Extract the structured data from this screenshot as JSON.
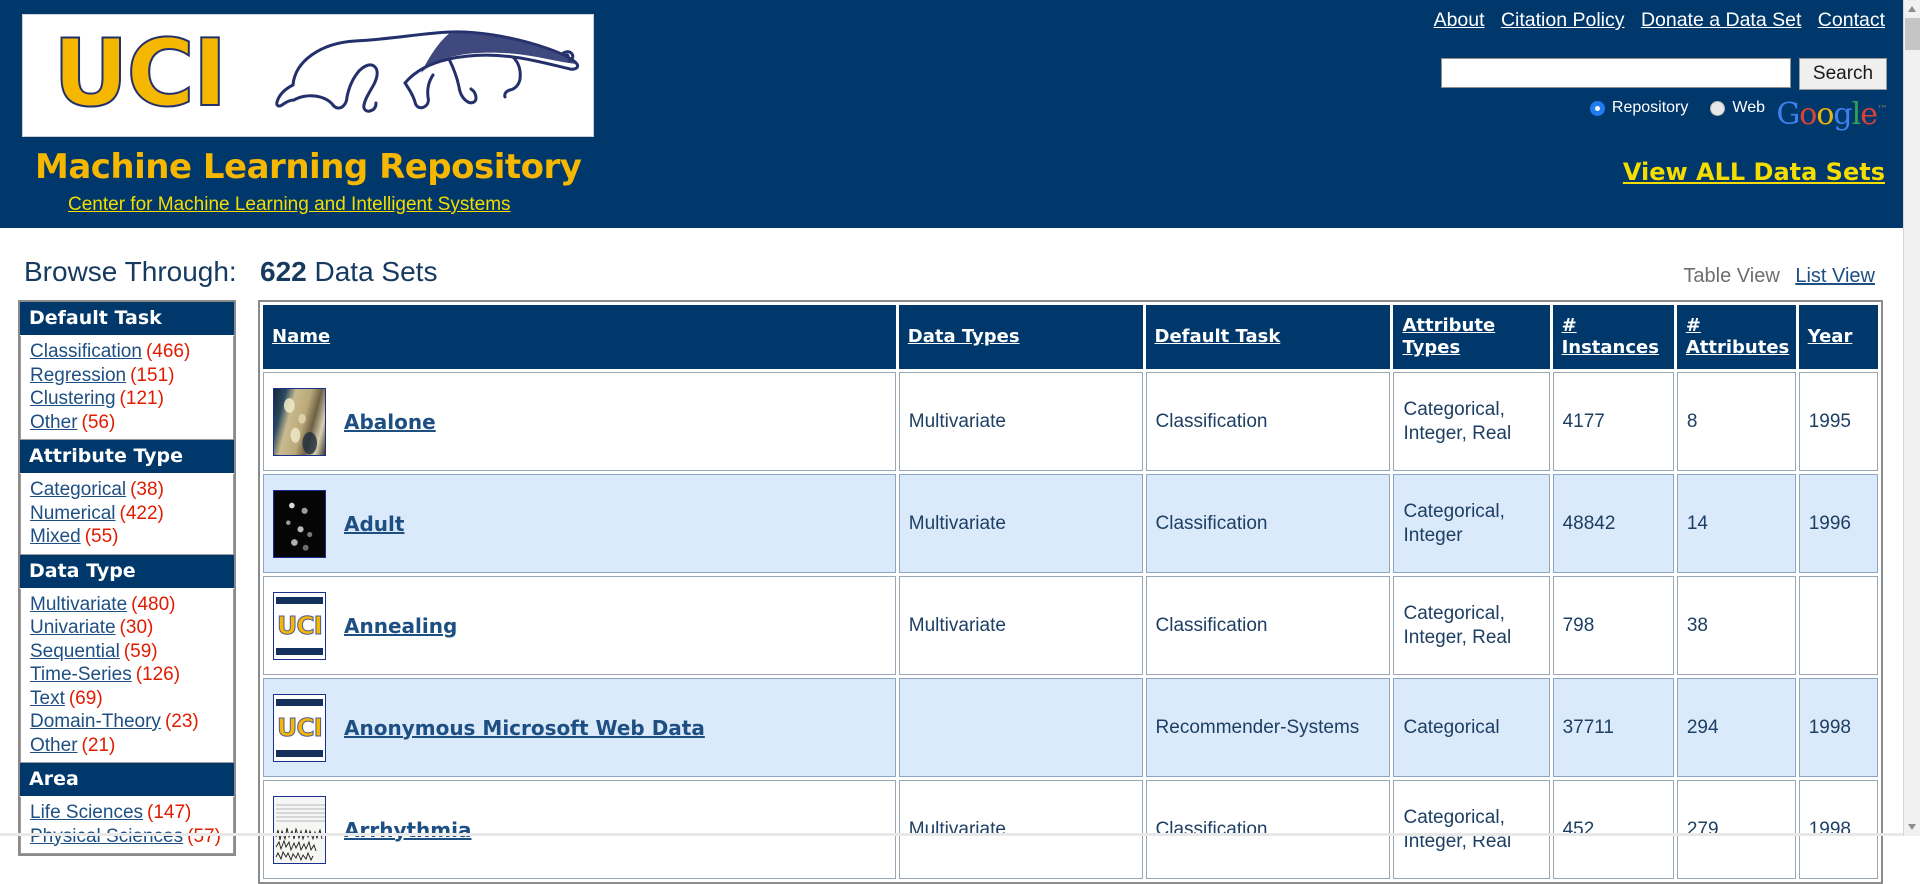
{
  "header": {
    "logo_text": "UCI",
    "logo_anteater_alt": "anteater-logo",
    "title": "Machine Learning Repository",
    "subtitle": "Center for Machine Learning and Intelligent Systems",
    "nav": [
      {
        "label": "About"
      },
      {
        "label": "Citation Policy"
      },
      {
        "label": "Donate a Data Set"
      },
      {
        "label": "Contact"
      }
    ],
    "search": {
      "value": "",
      "placeholder": "",
      "button_label": "Search",
      "scopes": [
        {
          "label": "Repository",
          "selected": true
        },
        {
          "label": "Web",
          "selected": false
        }
      ],
      "provider": "Google"
    },
    "view_all_label": "View ALL Data Sets",
    "colors": {
      "bar": "#01386b",
      "gold": "#f5b700",
      "link_gold": "#f5dd00"
    }
  },
  "browse": {
    "label": "Browse Through:",
    "count": "622",
    "count_suffix": "Data Sets",
    "view_current": "Table View",
    "view_other": "List View"
  },
  "sidebar": {
    "groups": [
      {
        "title": "Default Task",
        "items": [
          {
            "label": "Classification",
            "count": "(466)"
          },
          {
            "label": "Regression",
            "count": "(151)"
          },
          {
            "label": "Clustering",
            "count": "(121)"
          },
          {
            "label": "Other",
            "count": "(56)"
          }
        ]
      },
      {
        "title": "Attribute Type",
        "items": [
          {
            "label": "Categorical",
            "count": "(38)"
          },
          {
            "label": "Numerical",
            "count": "(422)"
          },
          {
            "label": "Mixed",
            "count": "(55)"
          }
        ]
      },
      {
        "title": "Data Type",
        "items": [
          {
            "label": "Multivariate",
            "count": "(480)"
          },
          {
            "label": "Univariate",
            "count": "(30)"
          },
          {
            "label": "Sequential",
            "count": "(59)"
          },
          {
            "label": "Time-Series",
            "count": "(126)"
          },
          {
            "label": "Text",
            "count": "(69)"
          },
          {
            "label": "Domain-Theory",
            "count": "(23)"
          },
          {
            "label": "Other",
            "count": "(21)"
          }
        ]
      },
      {
        "title": "Area",
        "items": [
          {
            "label": "Life Sciences",
            "count": "(147)"
          },
          {
            "label": "Physical Sciences",
            "count": "(57)"
          }
        ]
      }
    ]
  },
  "table": {
    "columns": [
      {
        "label": "Name"
      },
      {
        "label": "Data Types"
      },
      {
        "label": "Default Task"
      },
      {
        "label": "Attribute Types"
      },
      {
        "label": "# Instances"
      },
      {
        "label": "# Attributes"
      },
      {
        "label": "Year"
      }
    ],
    "rows": [
      {
        "thumb": "abalone-photo-thumbnail",
        "name": "Abalone",
        "data_types": "Multivariate",
        "default_task": "Classification",
        "attribute_types": "Categorical, Integer, Real",
        "instances": "4177",
        "attributes": "8",
        "year": "1995"
      },
      {
        "thumb": "adult-night-lights-thumbnail",
        "name": "Adult",
        "data_types": "Multivariate",
        "default_task": "Classification",
        "attribute_types": "Categorical, Integer",
        "instances": "48842",
        "attributes": "14",
        "year": "1996"
      },
      {
        "thumb": "uci-placeholder-thumbnail",
        "name": "Annealing",
        "data_types": "Multivariate",
        "default_task": "Classification",
        "attribute_types": "Categorical, Integer, Real",
        "instances": "798",
        "attributes": "38",
        "year": ""
      },
      {
        "thumb": "uci-placeholder-thumbnail",
        "name": "Anonymous Microsoft Web Data",
        "data_types": "",
        "default_task": "Recommender-Systems",
        "attribute_types": "Categorical",
        "instances": "37711",
        "attributes": "294",
        "year": "1998"
      },
      {
        "thumb": "arrhythmia-ecg-thumbnail",
        "name": "Arrhythmia",
        "data_types": "Multivariate",
        "default_task": "Classification",
        "attribute_types": "Categorical, Integer, Real",
        "instances": "452",
        "attributes": "279",
        "year": "1998"
      }
    ]
  }
}
